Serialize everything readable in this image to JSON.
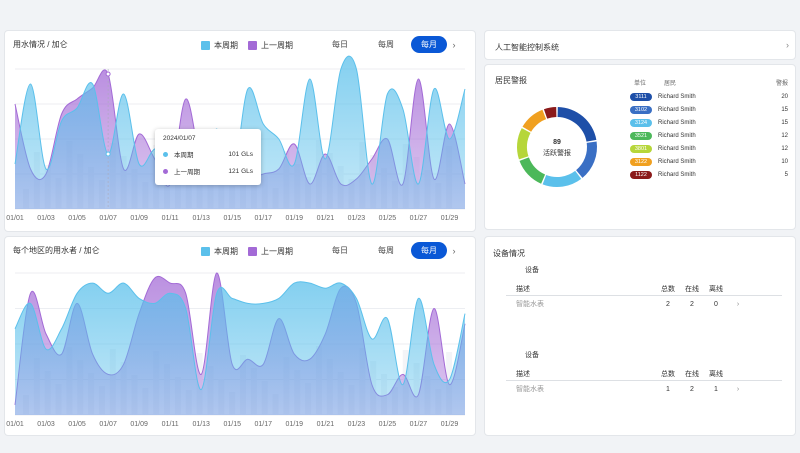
{
  "chart1": {
    "title": "用水情况 / 加仑",
    "legend": [
      "本周期",
      "上一周期"
    ],
    "tabs": [
      "每日",
      "每周",
      "每月"
    ],
    "active_tab": "每月",
    "nav_arrow": "›",
    "tooltip": {
      "date": "2024/01/07",
      "rows": [
        {
          "label": "本周期",
          "value": "101 GLs"
        },
        {
          "label": "上一周期",
          "value": "121 GLs"
        }
      ]
    }
  },
  "chart2": {
    "title": "每个地区的用水者 / 加仑",
    "legend": [
      "本周期",
      "上一周期"
    ],
    "tabs": [
      "每日",
      "每周",
      "每月"
    ],
    "active_tab": "每月",
    "nav_arrow": "›"
  },
  "chart_data": [
    {
      "type": "area",
      "title": "用水情况 / 加仑",
      "x": [
        "01/01",
        "01/02",
        "01/03",
        "01/04",
        "01/05",
        "01/06",
        "01/07",
        "01/08",
        "01/09",
        "01/10",
        "01/11",
        "01/12",
        "01/13",
        "01/14",
        "01/15",
        "01/16",
        "01/17",
        "01/18",
        "01/19",
        "01/20",
        "01/21",
        "01/22",
        "01/23",
        "01/24",
        "01/25",
        "01/26",
        "01/27",
        "01/28",
        "01/29",
        "01/30"
      ],
      "tick_labels": [
        "01/01",
        "01/03",
        "01/05",
        "01/07",
        "01/09",
        "01/11",
        "01/13",
        "01/15",
        "01/17",
        "01/19",
        "01/21",
        "01/23",
        "01/25",
        "01/27",
        "01/29"
      ],
      "ylim": [
        0,
        140
      ],
      "series": [
        {
          "name": "本周期",
          "color": "#5bc0eb",
          "values": [
            45,
            125,
            40,
            88,
            101,
            125,
            55,
            115,
            45,
            60,
            55,
            70,
            35,
            80,
            30,
            120,
            85,
            70,
            45,
            130,
            50,
            140,
            140,
            25,
            115,
            100,
            25,
            120,
            70,
            120
          ]
        },
        {
          "name": "上一周期",
          "color": "#a36ad6",
          "values": [
            105,
            40,
            35,
            95,
            110,
            121,
            135,
            40,
            75,
            50,
            25,
            110,
            45,
            25,
            30,
            30,
            35,
            40,
            65,
            25,
            55,
            25,
            30,
            50,
            70,
            25,
            130,
            30,
            85,
            25
          ]
        }
      ]
    },
    {
      "type": "area",
      "title": "每个地区的用水者 / 加仑",
      "x": [
        "01/01",
        "01/02",
        "01/03",
        "01/04",
        "01/05",
        "01/06",
        "01/07",
        "01/08",
        "01/09",
        "01/10",
        "01/11",
        "01/12",
        "01/13",
        "01/14",
        "01/15",
        "01/16",
        "01/17",
        "01/18",
        "01/19",
        "01/20",
        "01/21",
        "01/22",
        "01/23",
        "01/24",
        "01/25",
        "01/26",
        "01/27",
        "01/28",
        "01/29",
        "01/30"
      ],
      "tick_labels": [
        "01/01",
        "01/03",
        "01/05",
        "01/07",
        "01/09",
        "01/11",
        "01/13",
        "01/15",
        "01/17",
        "01/19",
        "01/21",
        "01/23",
        "01/25",
        "01/27",
        "01/29"
      ],
      "ylim": [
        0,
        140
      ],
      "series": [
        {
          "name": "本周期",
          "color": "#5bc0eb",
          "values": [
            85,
            110,
            65,
            85,
            120,
            130,
            120,
            130,
            115,
            110,
            120,
            105,
            25,
            120,
            115,
            110,
            110,
            115,
            130,
            130,
            125,
            130,
            115,
            75,
            95,
            30,
            115,
            50,
            35,
            100
          ]
        },
        {
          "name": "上一周期",
          "color": "#a36ad6",
          "values": [
            10,
            120,
            80,
            60,
            110,
            60,
            40,
            50,
            100,
            135,
            130,
            120,
            40,
            140,
            50,
            55,
            50,
            95,
            60,
            55,
            80,
            125,
            110,
            30,
            20,
            40,
            20,
            105,
            30,
            90
          ]
        }
      ]
    },
    {
      "type": "pie",
      "title": "居民警报",
      "center_value": "89",
      "center_label": "活跃警报",
      "slices": [
        {
          "label": "3111",
          "value": 20,
          "color": "#1e4fa8"
        },
        {
          "label": "3102",
          "value": 15,
          "color": "#3a6fc4"
        },
        {
          "label": "3124",
          "value": 15,
          "color": "#5bc0eb"
        },
        {
          "label": "3521",
          "value": 12,
          "color": "#4cb85a"
        },
        {
          "label": "3801",
          "value": 12,
          "color": "#b6d63a"
        },
        {
          "label": "3122",
          "value": 10,
          "color": "#f0a020"
        },
        {
          "label": "1122",
          "value": 5,
          "color": "#8b1a1a"
        }
      ]
    }
  ],
  "ai_card": {
    "title": "人工智能控制系统",
    "arrow": "›"
  },
  "alerts_card": {
    "title": "居民警报",
    "center_value": "89",
    "center_label": "活跃警报",
    "headers": [
      "单位",
      "居民",
      "警报"
    ],
    "rows": [
      {
        "unit": "3111",
        "name": "Richard Smith",
        "count": "20",
        "color": "#1e4fa8"
      },
      {
        "unit": "3102",
        "name": "Richard Smith",
        "count": "15",
        "color": "#3a6fc4"
      },
      {
        "unit": "3124",
        "name": "Richard Smith",
        "count": "15",
        "color": "#5bc0eb"
      },
      {
        "unit": "3521",
        "name": "Richard Smith",
        "count": "12",
        "color": "#4cb85a"
      },
      {
        "unit": "3801",
        "name": "Richard Smith",
        "count": "12",
        "color": "#b6d63a"
      },
      {
        "unit": "3122",
        "name": "Richard Smith",
        "count": "10",
        "color": "#f0a020"
      },
      {
        "unit": "1122",
        "name": "Richard Smith",
        "count": "5",
        "color": "#8b1a1a"
      }
    ]
  },
  "devices_card": {
    "title": "设备情况",
    "sections": [
      {
        "title": "设备",
        "headers": [
          "描述",
          "总数",
          "在线",
          "离线"
        ],
        "row": {
          "desc": "智能水表",
          "total": "2",
          "online": "2",
          "offline": "0",
          "arrow": "›"
        }
      },
      {
        "title": "设备",
        "headers": [
          "描述",
          "总数",
          "在线",
          "离线"
        ],
        "row": {
          "desc": "智能水表",
          "total": "1",
          "online": "2",
          "offline": "1",
          "arrow": "›"
        }
      }
    ]
  },
  "colors": {
    "current": "#5bc0eb",
    "previous": "#a36ad6",
    "accent": "#0a58d6"
  }
}
